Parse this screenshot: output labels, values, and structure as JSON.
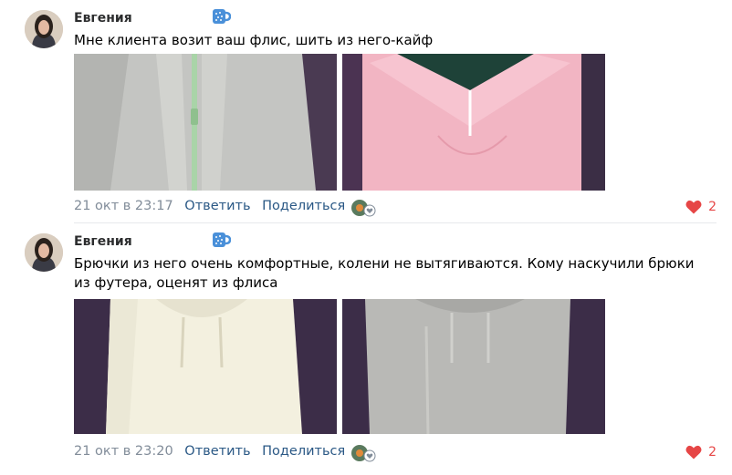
{
  "comments": [
    {
      "author": "Евгения",
      "text": "Мне клиента возит ваш флис, шить из него-кайф",
      "time": "21 окт в 23:17",
      "reply_label": "Ответить",
      "share_label": "Поделиться",
      "likes": "2",
      "photos": [
        {
          "icon": "grey-fleece-hoodie-photo",
          "color": "#c2c3c0"
        },
        {
          "icon": "pink-fleece-half-zip-photo",
          "color": "#f2b5c3"
        }
      ]
    },
    {
      "author": "Евгения",
      "text": "Брючки из него очень комфортные, колени не вытягиваются. Кому наскучили брюки из футера, оценят из флиса",
      "time": "21 окт в 23:20",
      "reply_label": "Ответить",
      "share_label": "Поделиться",
      "likes": "2",
      "photos": [
        {
          "icon": "cream-fleece-hoodie-photo",
          "color": "#f3f0df"
        },
        {
          "icon": "grey-fleece-sweatshirt-photo",
          "color": "#b9b9b6"
        }
      ]
    }
  ],
  "colors": {
    "accent": "#2a5885",
    "like": "#e64646",
    "meta": "#818c99"
  }
}
